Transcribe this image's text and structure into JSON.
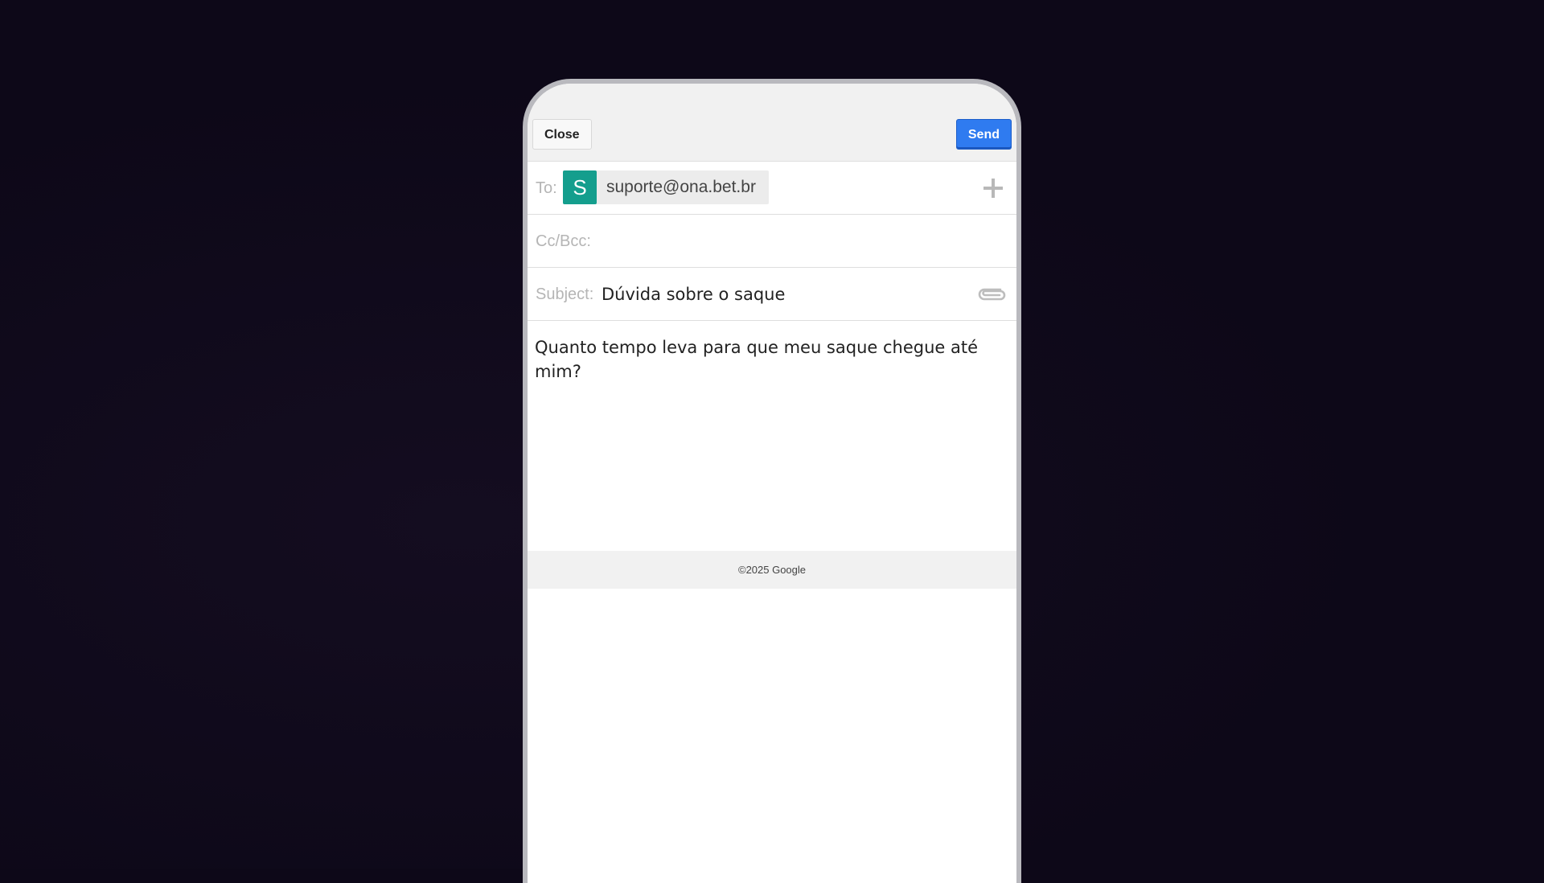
{
  "toolbar": {
    "close_label": "Close",
    "send_label": "Send"
  },
  "to": {
    "label": "To:",
    "recipient_initial": "S",
    "recipient_email": "suporte@ona.bet.br",
    "add_icon": "plus-icon"
  },
  "cc": {
    "label": "Cc/Bcc:"
  },
  "subject": {
    "label": "Subject:",
    "value": "Dúvida sobre o saque",
    "attach_icon": "paperclip-icon"
  },
  "body": {
    "text": "Quanto tempo leva para que meu saque chegue até mim?"
  },
  "footer": {
    "copyright": "©2025 Google"
  },
  "colors": {
    "send_button": "#2f7bf0",
    "avatar": "#149e8d",
    "background": "#0d0818"
  }
}
